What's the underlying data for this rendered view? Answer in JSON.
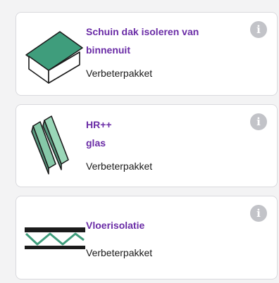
{
  "accent_color": "#6a2ca6",
  "cards": [
    {
      "title": "Schuin dak isoleren van\nbinnenuit",
      "subtitle": "Verbeterpakket",
      "icon": "pitched-roof-icon",
      "info_icon": "info-icon"
    },
    {
      "title": "HR++\nglas",
      "subtitle": "Verbeterpakket",
      "icon": "double-glazing-icon",
      "info_icon": "info-icon"
    },
    {
      "title": "Vloerisolatie",
      "subtitle": "Verbeterpakket",
      "icon": "floor-insulation-icon",
      "info_icon": "info-icon"
    }
  ]
}
